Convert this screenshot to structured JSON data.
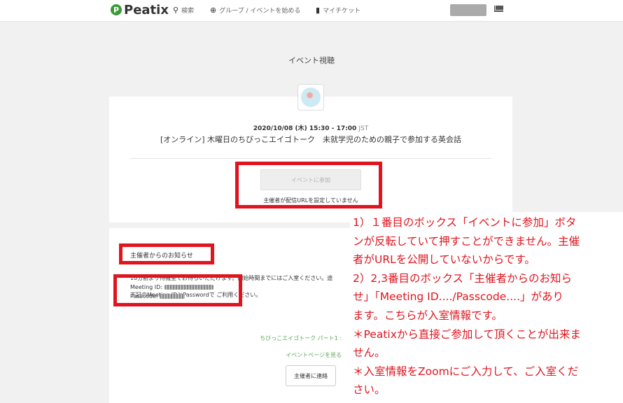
{
  "topbar": {
    "brand": "Peatix",
    "nav": {
      "search": "検索",
      "create": "グループ / イベントを始める",
      "tickets": "マイチケット"
    }
  },
  "page": {
    "heading": "イベント視聴"
  },
  "event": {
    "datetime": "2020/10/08 (木) 15:30 - 17:00",
    "timezone": "JST",
    "title": "[オンライン] 木曜日のちびっこエイゴトーク　未就学児のための親子で参加する英会話",
    "join_button": "イベントに参加",
    "url_note": "主催者が配信URLを設定していません"
  },
  "notice": {
    "heading": "主催者からのお知らせ",
    "body_line1": "10分前より待機室でお待ちいただけます。開始時間までにはご入室ください。途",
    "body_line2": "下記のMeeting IDとPasswordで ご利用ください。",
    "meeting_label": "Meeting ID:",
    "passcode_label": "Passcode:",
    "event_link": "ちびっこエイゴトーク パート1 :",
    "event_page_link": "イベントページを見る",
    "contact_button": "主催者に連絡"
  },
  "annotation": {
    "lines": [
      "1）１番目のボックス「イベントに参加」ボタ",
      "ンが反転していて押すことができません。主催",
      "者がURLを公開していないからです。",
      "2）2,3番目のボックス「主催者からのお知ら",
      "せ」「Meeting ID..../Passcode....」があり",
      "ます。こちらが入室情報です。",
      "＊Peatixから直接ご参加して頂くことが出来ま",
      "せん。",
      "＊入室情報をZoomにご入力して、ご入室くだ",
      "さい。"
    ]
  },
  "colors": {
    "brand_green": "#3c9a3a",
    "link_green": "#5aa857",
    "highlight_red": "#e0141e"
  }
}
